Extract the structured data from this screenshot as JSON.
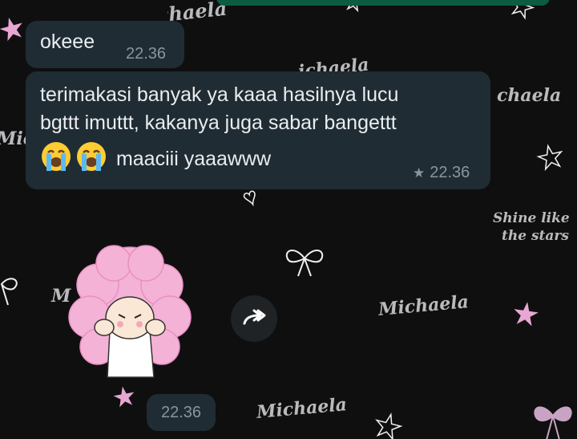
{
  "wallpaper": {
    "watermark_name": "Michaela",
    "name_fragment_partial": "M",
    "name_fragment_left": "Micl",
    "name_fragment_right": "chaela",
    "name_fragment_top": "ichaela",
    "tagline_line1": "Shine like",
    "tagline_line2": "the stars"
  },
  "messages": [
    {
      "id": "msg1",
      "text": "okeee",
      "time": "22.36",
      "starred": false
    },
    {
      "id": "msg2",
      "text_line1": "terimakasi banyak ya kaaa hasilnya lucu",
      "text_line2": "bgttt imuttt, kakanya juga sabar bangettt",
      "emojis": [
        "loudly-crying-face",
        "loudly-crying-face"
      ],
      "text_line3": "maaciii yaaawww",
      "time": "22.36",
      "starred": true
    },
    {
      "id": "msg3",
      "type": "sticker",
      "sticker_name": "pink-haired-girl-sticker",
      "time": "22.36"
    }
  ],
  "icons": {
    "forward": "forward-icon",
    "star": "star-icon"
  },
  "colors": {
    "bubble": "#202c33",
    "timestamp": "#8696a0",
    "text": "#e9edef",
    "accent_bar": "#0b5c43"
  }
}
